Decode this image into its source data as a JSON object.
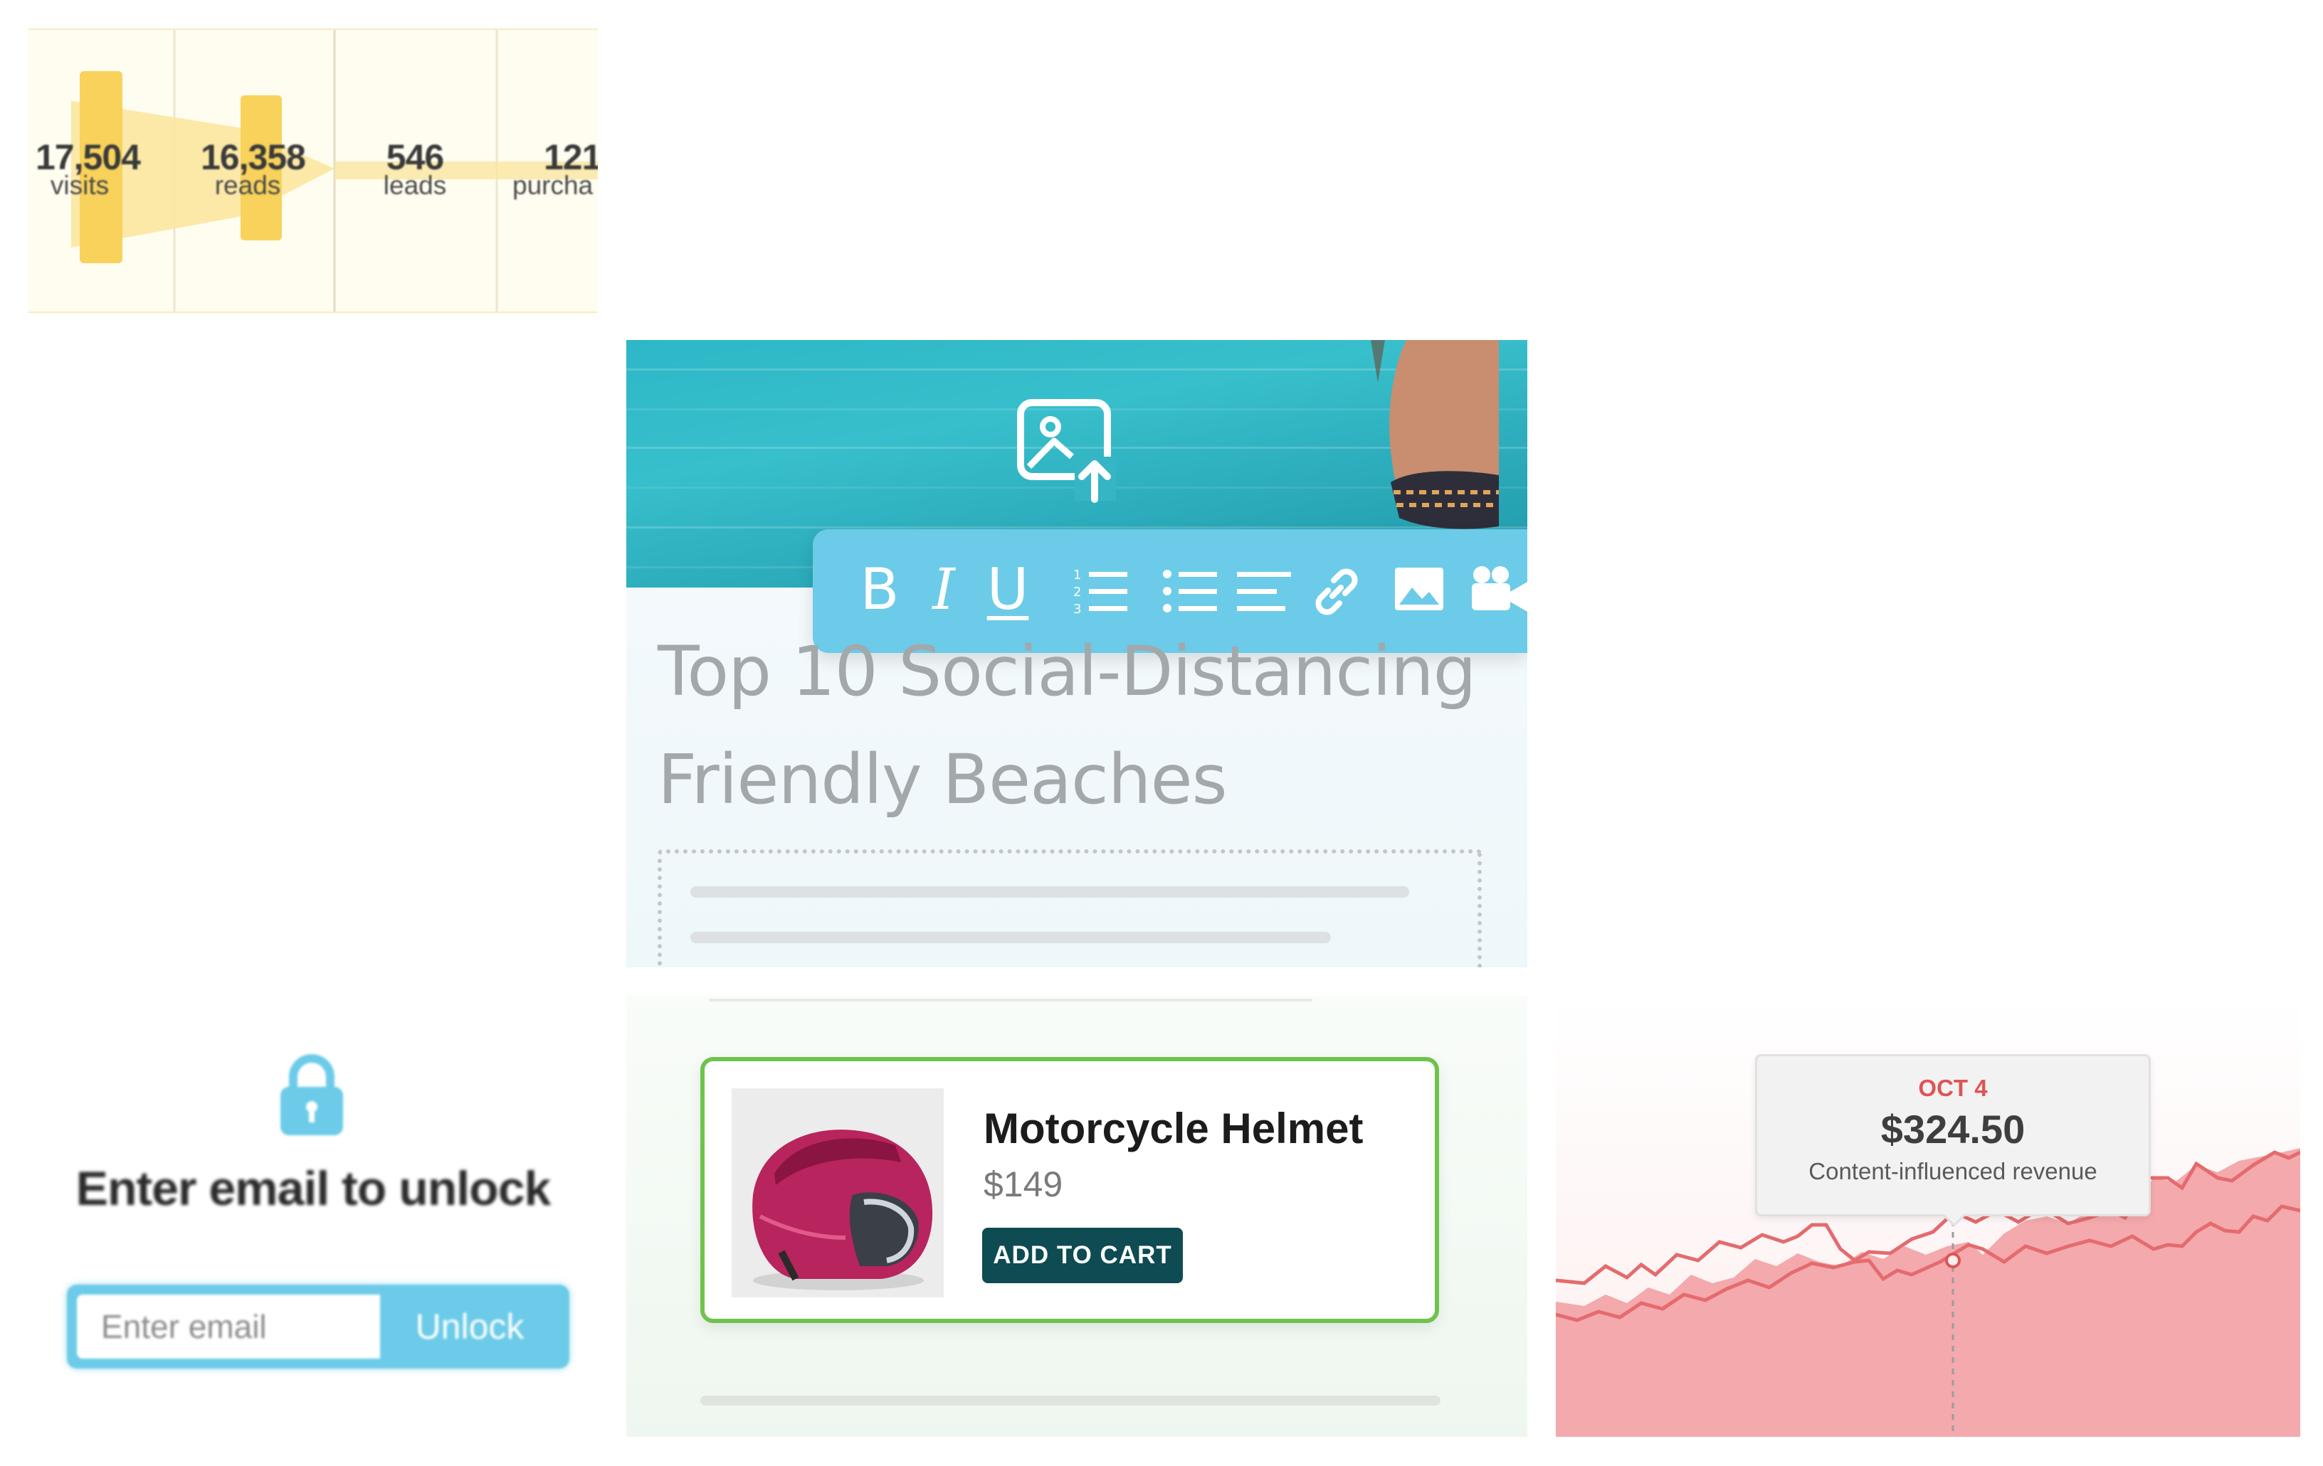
{
  "funnel": {
    "stages": [
      {
        "value": "17,504",
        "label": "visits"
      },
      {
        "value": "16,358",
        "label": "reads"
      },
      {
        "value": "546",
        "label": "leads"
      },
      {
        "value": "121",
        "label": "purcha"
      }
    ]
  },
  "editor": {
    "title": "Top 10 Social-Distancing Friendly Beaches",
    "toolbar": {
      "bold": "B",
      "italic": "I",
      "underline": "U"
    }
  },
  "lock": {
    "title": "Enter email to unlock",
    "email_placeholder": "Enter email",
    "button": "Unlock"
  },
  "product": {
    "name": "Motorcycle Helmet",
    "price": "$149",
    "cta": "ADD TO CART"
  },
  "revenue": {
    "tooltip": {
      "date": "OCT 4",
      "value": "$324.50",
      "label": "Content-influenced revenue"
    }
  },
  "colors": {
    "brand_blue": "#6ccbe8",
    "cta_green_dark": "#0e4b52",
    "card_border_green": "#6fc34d",
    "chart_line": "#e66767",
    "chart_fill": "#f4a9ad"
  }
}
